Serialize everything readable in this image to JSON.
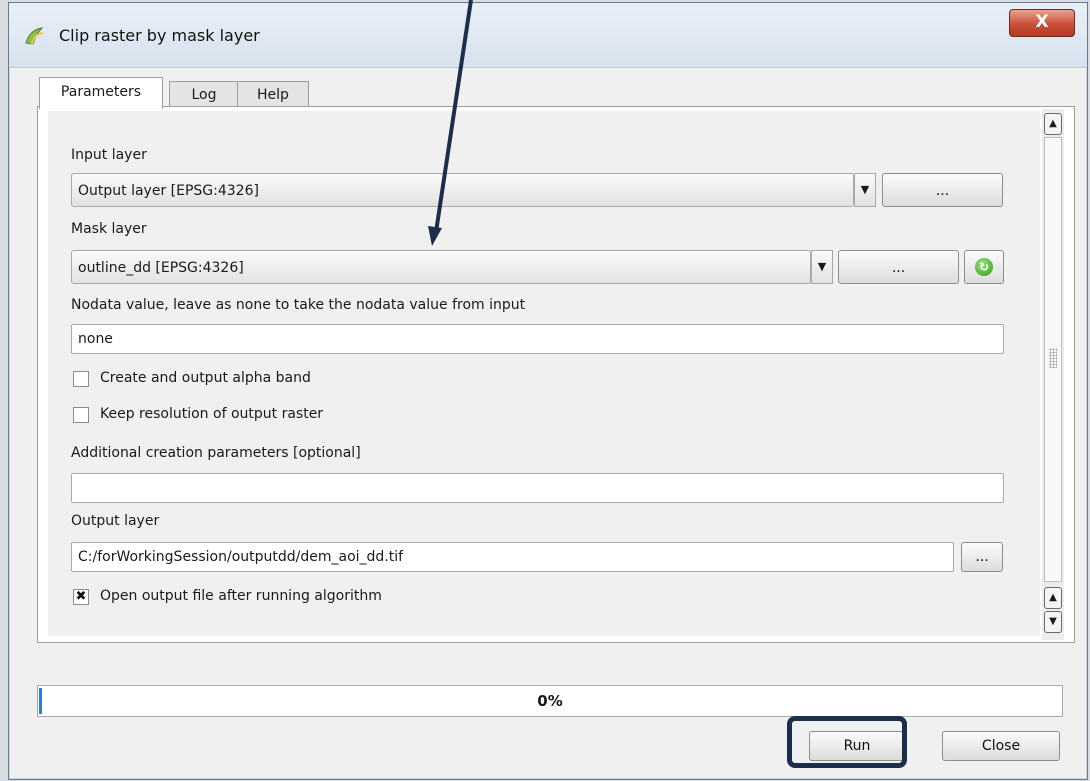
{
  "window": {
    "title": "Clip raster by mask layer",
    "close_glyph": "X"
  },
  "tabs": [
    {
      "label": "Parameters",
      "active": true
    },
    {
      "label": "Log",
      "active": false
    },
    {
      "label": "Help",
      "active": false
    }
  ],
  "form": {
    "input_layer": {
      "label": "Input layer",
      "value": "Output layer [EPSG:4326]",
      "browse_label": "..."
    },
    "mask_layer": {
      "label": "Mask layer",
      "value": "outline_dd [EPSG:4326]",
      "browse_label": "..."
    },
    "nodata": {
      "label": "Nodata value, leave as none to take the nodata value from input",
      "value": "none"
    },
    "alpha_band": {
      "label": "Create and output alpha band",
      "checked": false
    },
    "keep_resolution": {
      "label": "Keep resolution of output raster",
      "checked": false
    },
    "creation_params": {
      "label": "Additional creation parameters [optional]",
      "value": ""
    },
    "output_layer": {
      "label": "Output layer",
      "value": "C:/forWorkingSession/outputdd/dem_aoi_dd.tif",
      "browse_label": "..."
    },
    "open_output": {
      "label": "Open output file after running algorithm",
      "checked": true,
      "check_glyph": "✖"
    }
  },
  "progress": {
    "text": "0%",
    "value": 0
  },
  "buttons": {
    "run": "Run",
    "close": "Close"
  },
  "icons": {
    "app": "qgis-icon",
    "refresh": "refresh-icon",
    "dropdown": "chevron-down-icon",
    "scroll_up": "scroll-up-icon",
    "scroll_down": "scroll-down-icon"
  },
  "colors": {
    "annotation": "#1b2f4d",
    "progress": "#2a7fd8",
    "close_button": "#c9503a"
  }
}
